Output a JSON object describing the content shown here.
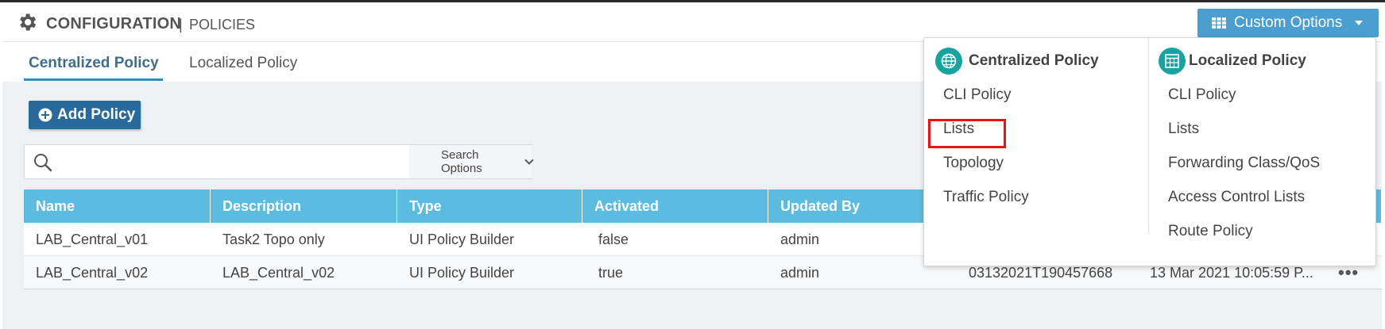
{
  "header": {
    "title": "CONFIGURATION",
    "separator": "|",
    "subtitle": "POLICIES",
    "gear_icon": "gear-icon",
    "custom_options_label": "Custom Options"
  },
  "tabs": [
    {
      "label": "Centralized Policy",
      "active": true
    },
    {
      "label": "Localized Policy",
      "active": false
    }
  ],
  "toolbar": {
    "add_policy_label": "Add Policy",
    "search_placeholder": "",
    "search_options_label": "Search Options"
  },
  "table": {
    "columns": [
      "Name",
      "Description",
      "Type",
      "Activated",
      "Updated By",
      "",
      "",
      ""
    ],
    "rows": [
      [
        "LAB_Central_v01",
        "Task2 Topo only",
        "UI Policy Builder",
        "false",
        "admin",
        "",
        "",
        ""
      ],
      [
        "LAB_Central_v02",
        "LAB_Central_v02",
        "UI Policy Builder",
        "true",
        "admin",
        "03132021T190457668",
        "13 Mar 2021 10:05:59 P...",
        "•••"
      ]
    ]
  },
  "dropdown": {
    "centralized": {
      "heading": "Centralized Policy",
      "icon": "globe-icon",
      "items": [
        "CLI Policy",
        "Lists",
        "Topology",
        "Traffic Policy"
      ]
    },
    "localized": {
      "heading": "Localized Policy",
      "icon": "grid-icon",
      "items": [
        "CLI Policy",
        "Lists",
        "Forwarding Class/QoS",
        "Access Control Lists",
        "Route Policy"
      ]
    },
    "highlighted_item": "Lists"
  },
  "colors": {
    "accent": "#4a9fd0",
    "table_header": "#5bbce0",
    "add_button": "#276a9b",
    "dropdown_icon": "#17a4a0",
    "highlight": "#ee1111"
  }
}
